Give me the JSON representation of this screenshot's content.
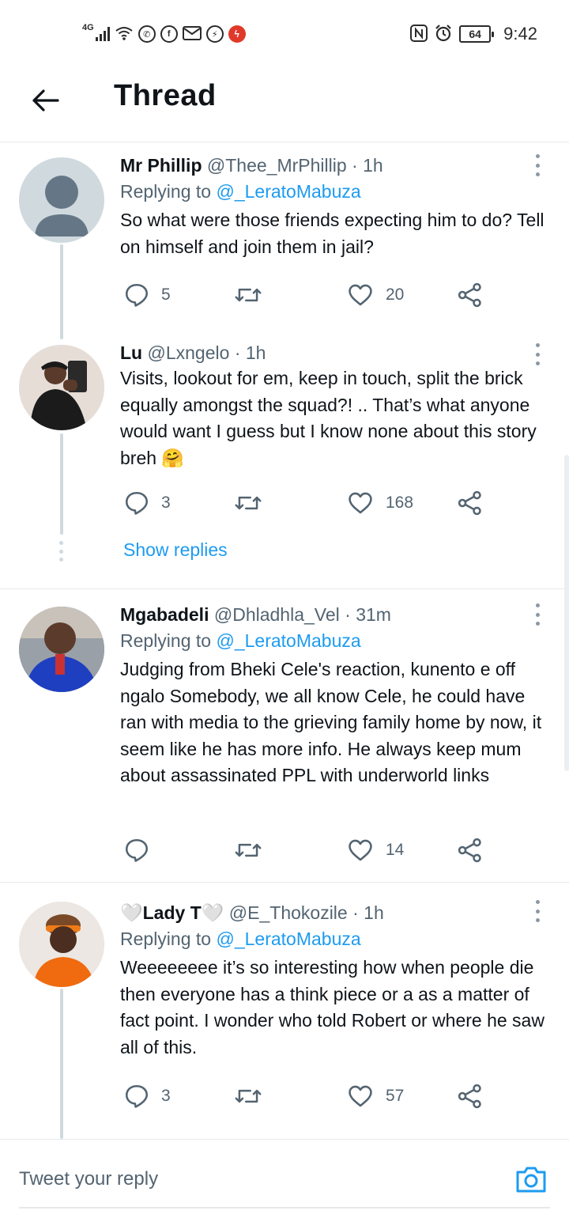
{
  "status_bar": {
    "network": "4G",
    "battery": "64",
    "time": "9:42",
    "icons": [
      "signal-icon",
      "wifi-icon",
      "whatsapp-icon",
      "facebook-icon",
      "mail-icon",
      "messenger-icon",
      "notification-icon",
      "nfc-icon",
      "alarm-icon",
      "battery-icon"
    ]
  },
  "header": {
    "title": "Thread"
  },
  "tweets": [
    {
      "display_name": "Mr Phillip",
      "handle": "@Thee_MrPhillip",
      "sep": "·",
      "time": "1h",
      "replying_prefix": "Replying to",
      "replying_to": "@_LeratoMabuza",
      "text": "So what were those friends expecting him to do? Tell on himself and join them in jail?",
      "replies": "5",
      "retweets": "",
      "likes": "20"
    },
    {
      "display_name": "Lu",
      "handle": "@Lxngelo",
      "sep": "·",
      "time": "1h",
      "text": "Visits, lookout for em, keep in touch, split the brick equally amongst the squad?!  .. That’s what anyone would want I guess but I know none about this story breh 🤗",
      "replies": "3",
      "retweets": "",
      "likes": "168",
      "show_replies": "Show replies"
    },
    {
      "display_name": "Mgabadeli",
      "handle": "@Dhladhla_Vel",
      "sep": "·",
      "time": "31m",
      "replying_prefix": "Replying to",
      "replying_to": "@_LeratoMabuza",
      "text": "Judging from Bheki Cele's reaction, kunento e off ngalo Somebody, we all know Cele, he could have ran with media to the grieving family home by now, it seem like he has more info. He always keep mum about assassinated PPL with underworld  links",
      "replies": "",
      "retweets": "",
      "likes": "14"
    },
    {
      "display_name": "🤍Lady T🤍",
      "handle": "@E_Thokozile",
      "sep": "·",
      "time": "1h",
      "replying_prefix": "Replying to",
      "replying_to": "@_LeratoMabuza",
      "text": "Weeeeeeee it’s so interesting how when people die then everyone has a think piece or a as a matter of fact point. I wonder who told Robert or where he saw all of this.",
      "replies": "3",
      "retweets": "",
      "likes": "57"
    }
  ],
  "reply_bar": {
    "placeholder": "Tweet your reply"
  },
  "colors": {
    "accent": "#1d9bf0",
    "secondary_text": "#536471",
    "thread_line": "#cfd9de"
  }
}
